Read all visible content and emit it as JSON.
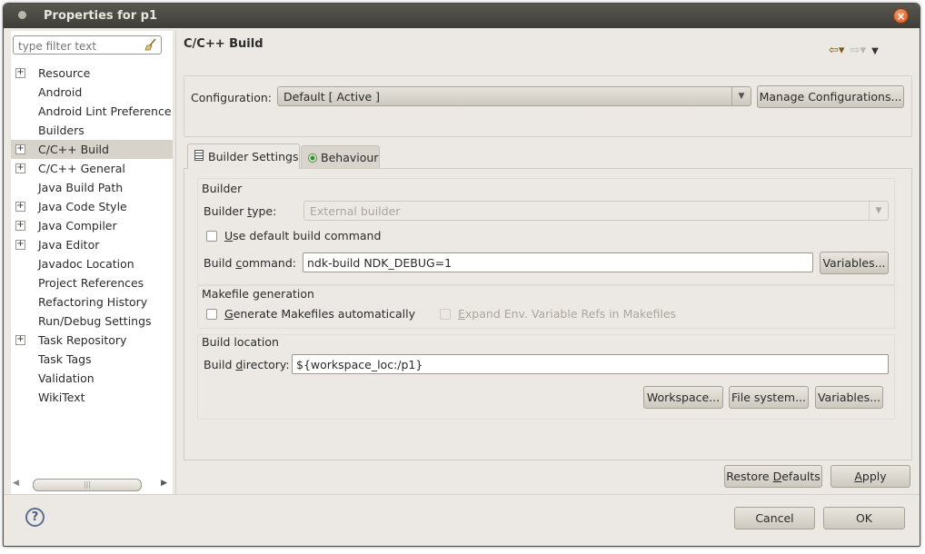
{
  "window": {
    "title": "Properties for p1"
  },
  "filter": {
    "placeholder": "type filter text"
  },
  "tree": [
    {
      "label": "Resource",
      "expandable": true,
      "selected": false
    },
    {
      "label": "Android",
      "expandable": false,
      "selected": false
    },
    {
      "label": "Android Lint Preference",
      "expandable": false,
      "selected": false
    },
    {
      "label": "Builders",
      "expandable": false,
      "selected": false
    },
    {
      "label": "C/C++ Build",
      "expandable": true,
      "selected": true
    },
    {
      "label": "C/C++ General",
      "expandable": true,
      "selected": false
    },
    {
      "label": "Java Build Path",
      "expandable": false,
      "selected": false
    },
    {
      "label": "Java Code Style",
      "expandable": true,
      "selected": false
    },
    {
      "label": "Java Compiler",
      "expandable": true,
      "selected": false
    },
    {
      "label": "Java Editor",
      "expandable": true,
      "selected": false
    },
    {
      "label": "Javadoc Location",
      "expandable": false,
      "selected": false
    },
    {
      "label": "Project References",
      "expandable": false,
      "selected": false
    },
    {
      "label": "Refactoring History",
      "expandable": false,
      "selected": false
    },
    {
      "label": "Run/Debug Settings",
      "expandable": false,
      "selected": false
    },
    {
      "label": "Task Repository",
      "expandable": true,
      "selected": false
    },
    {
      "label": "Task Tags",
      "expandable": false,
      "selected": false
    },
    {
      "label": "Validation",
      "expandable": false,
      "selected": false
    },
    {
      "label": "WikiText",
      "expandable": false,
      "selected": false
    }
  ],
  "page": {
    "title": "C/C++ Build"
  },
  "config": {
    "label": "Configuration:",
    "value": "Default  [ Active ]",
    "manage_label": "Manage Configurations..."
  },
  "tabs": [
    {
      "label": "Builder Settings",
      "active": true
    },
    {
      "label": "Behaviour",
      "active": false
    }
  ],
  "builder": {
    "group_label": "Builder",
    "type_label_pre": "Builder ",
    "type_label_u": "t",
    "type_label_post": "ype:",
    "type_value": "External builder",
    "use_default_pre": "",
    "use_default_u": "U",
    "use_default_post": "se default build command",
    "use_default_checked": false,
    "command_label_pre": "Build ",
    "command_label_u": "c",
    "command_label_post": "ommand:",
    "command_value": "ndk-build NDK_DEBUG=1",
    "variables_label": "Variables..."
  },
  "makefile": {
    "group_label": "Makefile generation",
    "generate_pre": "",
    "generate_u": "G",
    "generate_post": "enerate Makefiles automatically",
    "generate_checked": false,
    "expand_pre": "",
    "expand_u": "E",
    "expand_post": "xpand Env. Variable Refs in Makefiles",
    "expand_checked": false
  },
  "location": {
    "group_label": "Build location",
    "dir_label_pre": "Build ",
    "dir_label_u": "d",
    "dir_label_post": "irectory:",
    "dir_value": "${workspace_loc:/p1}",
    "workspace_label": "Workspace...",
    "filesystem_label": "File system...",
    "variables_label": "Variables..."
  },
  "buttons": {
    "restore_pre": "Restore ",
    "restore_u": "D",
    "restore_post": "efaults",
    "apply_u": "A",
    "apply_post": "pply",
    "cancel": "Cancel",
    "ok": "OK"
  },
  "colors": {
    "selection": "#d7d3cb",
    "titlebar": "#4b4a44",
    "close": "#e06a34"
  }
}
